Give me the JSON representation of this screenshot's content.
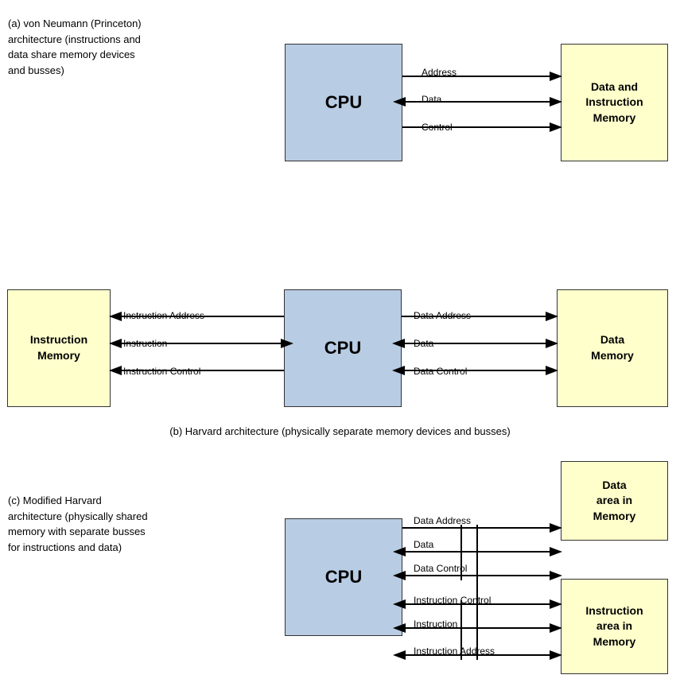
{
  "diagrams": {
    "a": {
      "title": "(a) von Neumann (Princeton)\narchitecture (instructions and\ndata share memory devices\nand busses)",
      "cpu_label": "CPU",
      "mem_label": "Data and\nInstruction\nMemory",
      "arrows": [
        {
          "label": "Address",
          "direction": "right"
        },
        {
          "label": "Data",
          "direction": "both"
        },
        {
          "label": "Control",
          "direction": "right"
        }
      ]
    },
    "b": {
      "caption": "(b) Harvard architecture (physically separate memory devices and busses)",
      "cpu_label": "CPU",
      "left_mem_label": "Instruction\nMemory",
      "right_mem_label": "Data\nMemory",
      "left_arrows": [
        {
          "label": "Instruction Address",
          "direction": "left"
        },
        {
          "label": "Instruction",
          "direction": "both"
        },
        {
          "label": "Instruction Control",
          "direction": "left"
        }
      ],
      "right_arrows": [
        {
          "label": "Data Address",
          "direction": "right"
        },
        {
          "label": "Data",
          "direction": "both"
        },
        {
          "label": "Data Control",
          "direction": "both"
        }
      ]
    },
    "c": {
      "title": "(c) Modified Harvard\narchitecture (physically shared\nmemory with separate busses\nfor instructions and data)",
      "cpu_label": "CPU",
      "top_mem_label": "Data\narea in\nMemory",
      "bottom_mem_label": "Instruction\narea in\nMemory",
      "top_arrows": [
        {
          "label": "Data Address",
          "direction": "right"
        },
        {
          "label": "Data",
          "direction": "both"
        },
        {
          "label": "Data Control",
          "direction": "both"
        }
      ],
      "bottom_arrows": [
        {
          "label": "Instruction Control",
          "direction": "both"
        },
        {
          "label": "Instruction",
          "direction": "left"
        },
        {
          "label": "Instruction Address",
          "direction": "left"
        }
      ]
    }
  }
}
